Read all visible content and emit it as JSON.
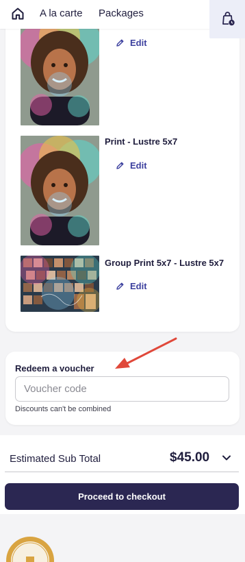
{
  "nav": {
    "home_icon": "home-icon",
    "links": [
      "A la carte",
      "Packages"
    ],
    "cart_icon": "shopping-bag-clock-icon"
  },
  "cart": {
    "items": [
      {
        "title": "",
        "edit_label": "Edit",
        "thumbnail": "portrait-photo"
      },
      {
        "title": "Print - Lustre 5x7",
        "edit_label": "Edit",
        "thumbnail": "portrait-photo"
      },
      {
        "title": "Group Print 5x7 - Lustre 5x7",
        "edit_label": "Edit",
        "thumbnail": "group-photo"
      }
    ]
  },
  "voucher": {
    "title": "Redeem a voucher",
    "placeholder": "Voucher code",
    "note": "Discounts can't be combined"
  },
  "totals": {
    "label": "Estimated Sub Total",
    "value": "$45.00"
  },
  "checkout": {
    "label": "Proceed to checkout"
  },
  "colors": {
    "primary_dark": "#2b2752",
    "accent_link": "#3b3f9e",
    "annotation_arrow": "#e0483a",
    "badge_gold": "#d9a441"
  }
}
